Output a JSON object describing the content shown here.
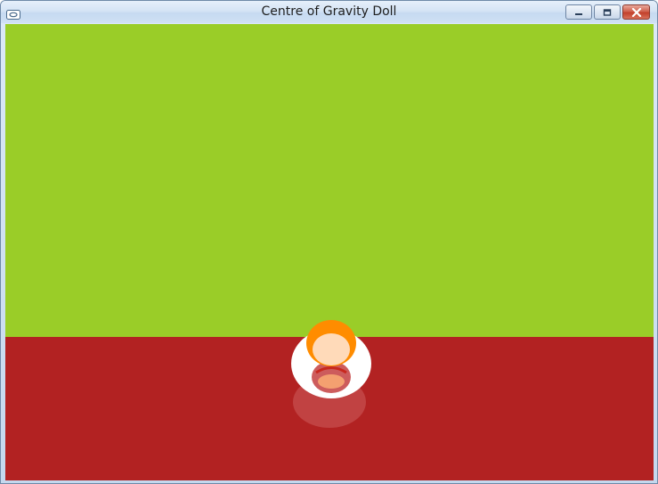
{
  "window": {
    "title": "Centre of Gravity Doll",
    "icon": "app-window-icon",
    "buttons": [
      {
        "name": "minimize-button",
        "icon": "minimize-icon"
      },
      {
        "name": "maximize-button",
        "icon": "maximize-icon"
      },
      {
        "name": "close-button",
        "icon": "close-icon"
      }
    ]
  },
  "scene": {
    "sky_color": "#9acd28",
    "floor_color": "#b22222",
    "doll_colors": {
      "head_outer": "#ff8c00",
      "face": "#ffdab9",
      "body": "#ffffff",
      "base_shadow": "#cd5c5c",
      "inner_shape": "#f4a070"
    }
  }
}
